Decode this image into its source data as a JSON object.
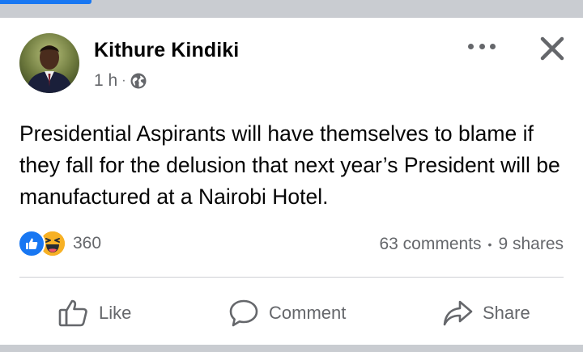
{
  "post": {
    "author": "Kithure Kindiki",
    "time": "1 h",
    "separator": "·",
    "privacy_icon": "globe-icon",
    "text": "Presidential Aspirants will have themselves to blame if they fall for the delusion that next year’s President will be manufactured at a Nairobi Hotel."
  },
  "reactions": {
    "icons": [
      "like-reaction-icon",
      "haha-reaction-icon"
    ],
    "count": "360"
  },
  "stats": {
    "comments": "63 comments",
    "dot": "•",
    "shares": "9 shares"
  },
  "actions": {
    "like": "Like",
    "comment": "Comment",
    "share": "Share"
  },
  "colors": {
    "accent": "#1877f2",
    "secondary_text": "#65676b",
    "separator_gray": "#c9ccd1"
  }
}
